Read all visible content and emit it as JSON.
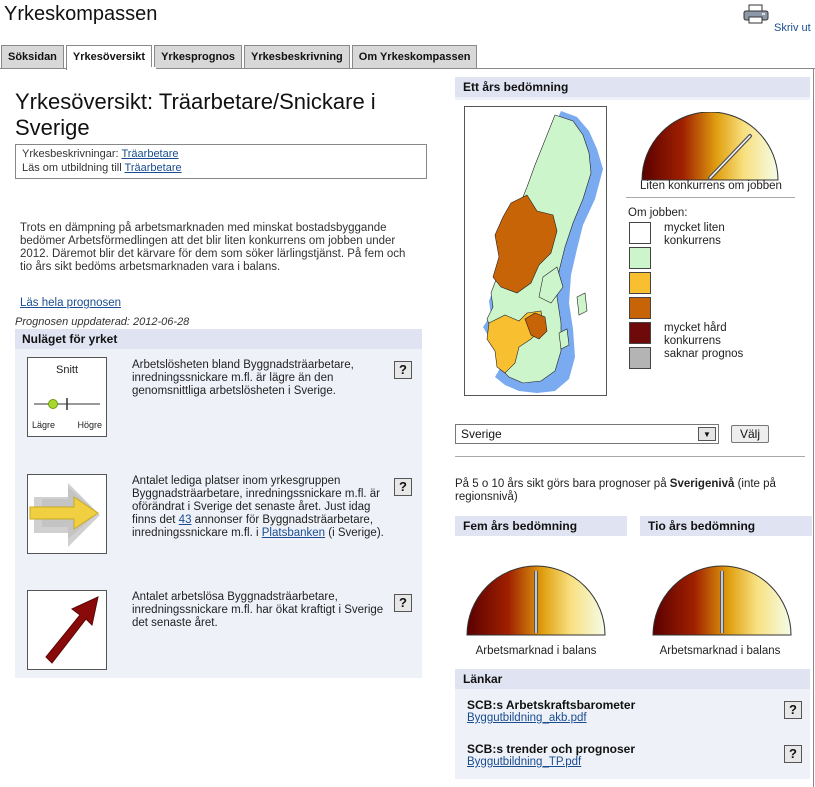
{
  "app": {
    "title": "Yrkeskompassen",
    "print_label": "Skriv ut"
  },
  "tabs": [
    {
      "label": "Söksidan"
    },
    {
      "label": "Yrkesöversikt"
    },
    {
      "label": "Yrkesprognos"
    },
    {
      "label": "Yrkesbeskrivning"
    },
    {
      "label": "Om Yrkeskompassen"
    }
  ],
  "main": {
    "title": "Yrkesöversikt: Träarbetare/Snickare i Sverige",
    "descriptions_label": "Yrkesbeskrivningar:",
    "descriptions_link": "Träarbetare",
    "education_label": "Läs om utbildning till",
    "education_link": "Träarbetare",
    "summary": "Trots en dämpning på arbetsmarknaden med minskat bostadsbyggande bedömer Arbetsförmedlingen att det blir liten konkurrens om jobben under 2012. Däremot blir det kärvare för dem som söker lärlingstjänst. På fem och tio års sikt bedöms arbetsmarknaden vara i balans.",
    "read_more": "Läs hela prognosen",
    "updated": "Prognosen uppdaterad: 2012-06-28"
  },
  "nulaget": {
    "heading": "Nuläget för yrket",
    "help": "?",
    "card1": {
      "title": "Snitt",
      "low": "Lägre",
      "high": "Högre"
    },
    "item1": "Arbetslösheten bland Byggnadsträarbetare, inredningssnickare m.fl. är lägre än den genomsnittliga arbetslösheten i Sverige.",
    "item2_before": "Antalet lediga platser inom yrkesgruppen Byggnadsträarbetare, inredningssnickare m.fl. är oförändrat i Sverige det senaste året. Just idag finns det ",
    "item2_count": "43",
    "item2_middle": " annonser för Byggnadsträarbetare, inredningssnickare m.fl. i ",
    "item2_link": "Platsbanken",
    "item2_after": " (i Sverige).",
    "item3": "Antalet arbetslösa Byggnadsträarbetare, inredningssnickare m.fl. har ökat kraftigt i Sverige det senaste året."
  },
  "right": {
    "one_year_heading": "Ett års bedömning",
    "one_year_gauge_label": "Liten konkurrens om jobben",
    "legend_title": "Om jobben:",
    "legend": [
      {
        "label": "mycket liten konkurrens",
        "color": "#ffffff"
      },
      {
        "label": "",
        "color": "#ccf5cc"
      },
      {
        "label": "",
        "color": "#f8c030"
      },
      {
        "label": "",
        "color": "#c86408"
      },
      {
        "label": "mycket hård konkurrens",
        "color": "#6e0a0a"
      },
      {
        "label": "saknar prognos",
        "color": "#b4b4b4"
      }
    ],
    "region_select": "Sverige",
    "valj_button": "Välj",
    "note_before": "På 5 o 10 års sikt görs bara prognoser på ",
    "note_bold": "Sverigenivå",
    "note_after": " (inte på regionsnivå)",
    "five_year_heading": "Fem års bedömning",
    "ten_year_heading": "Tio års bedömning",
    "balance_label": "Arbetsmarknad i balans",
    "links_heading": "Länkar",
    "links": [
      {
        "title": "SCB:s Arbetskraftsbarometer",
        "file": "Byggutbildning_akb.pdf"
      },
      {
        "title": "SCB:s trender och prognoser",
        "file": "Byggutbildning_TP.pdf"
      }
    ]
  }
}
